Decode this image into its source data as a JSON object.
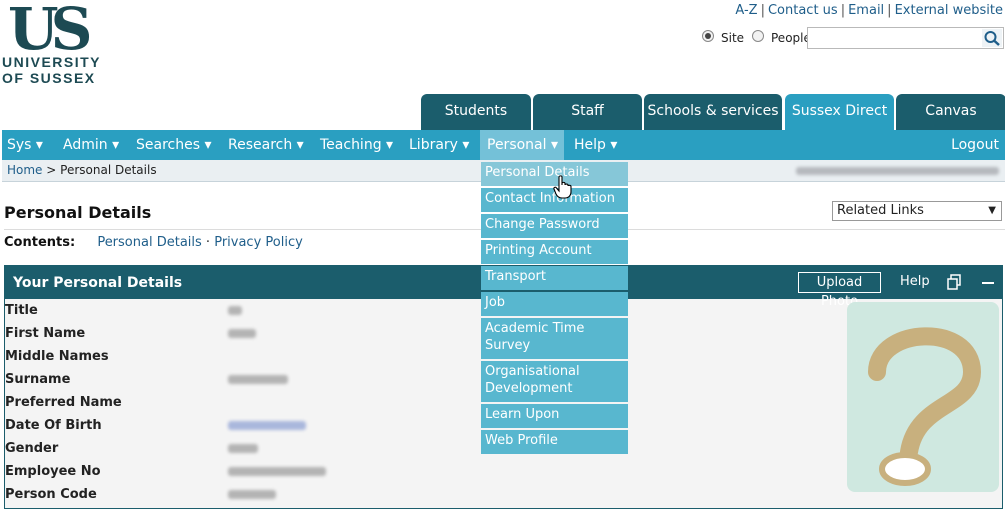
{
  "logo": {
    "mark": "US",
    "line1": "UNIVERSITY",
    "line2": "OF SUSSEX"
  },
  "toplinks": [
    "A-Z",
    "Contact us",
    "Email",
    "External website"
  ],
  "search": {
    "option_site": "Site",
    "option_people": "People",
    "selected": "Site",
    "value": "",
    "icon": "search-icon"
  },
  "tabs": [
    {
      "label": "Students"
    },
    {
      "label": "Staff"
    },
    {
      "label": "Schools & services"
    },
    {
      "label": "Sussex Direct",
      "active": true
    },
    {
      "label": "Canvas"
    }
  ],
  "nav": {
    "items": [
      "Sys ▾",
      "Admin ▾",
      "Searches ▾",
      "Research ▾",
      "Teaching ▾",
      "Library ▾",
      "Personal ▾",
      "Help ▾"
    ],
    "open_item": "Personal ▾",
    "logout": "Logout"
  },
  "breadcrumb": {
    "home": "Home",
    "separator": ">",
    "current": "Personal Details"
  },
  "page": {
    "title": "Personal Details",
    "related_links": "Related Links",
    "contents_label": "Contents:",
    "contents_links": [
      "Personal Details",
      "Privacy Policy"
    ],
    "contents_sep": "·"
  },
  "panel": {
    "title": "Your Personal Details",
    "upload_photo": "Upload Photo",
    "help": "Help",
    "fields": [
      "Title",
      "First Name",
      "Middle Names",
      "Surname",
      "Preferred Name",
      "Date Of Birth",
      "Gender",
      "Employee No",
      "Person Code"
    ]
  },
  "dropdown": {
    "items": [
      "Personal Details",
      "Contact Information",
      "Change Password",
      "Printing Account",
      "Transport",
      "Job",
      "Academic Time Survey",
      "Organisational Development",
      "Learn Upon",
      "Web Profile"
    ],
    "hovered": "Personal Details"
  },
  "colors": {
    "brand": "#1d4a53",
    "tab_dark": "#1b5d6c",
    "accent": "#2a9fc1",
    "menu_item": "#58b7cf",
    "link": "#1f5e8a"
  }
}
